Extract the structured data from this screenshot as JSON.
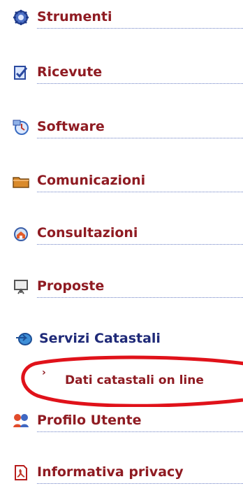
{
  "menu": {
    "items": [
      {
        "label": "Strumenti",
        "icon": "gear-icon"
      },
      {
        "label": "Ricevute",
        "icon": "receipt-checkmark-icon"
      },
      {
        "label": "Software",
        "icon": "software-install-icon"
      },
      {
        "label": "Comunicazioni",
        "icon": "folder-icon"
      },
      {
        "label": "Consultazioni",
        "icon": "home-search-icon"
      },
      {
        "label": "Proposte",
        "icon": "presentation-board-icon"
      },
      {
        "label": "Servizi Catastali",
        "icon": "globe-arrow-icon"
      },
      {
        "label": "Profilo Utente",
        "icon": "users-icon"
      },
      {
        "label": "Informativa privacy",
        "icon": "pdf-document-icon"
      }
    ],
    "subitem": {
      "caret": "›",
      "label": "Dati catastali on line"
    }
  },
  "colors": {
    "label": "#8f1b22",
    "section": "#1f2a78",
    "rule": "#6b7fc4",
    "highlight": "#e0121a"
  }
}
